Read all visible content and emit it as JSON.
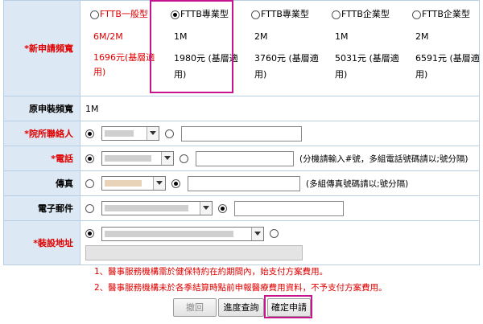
{
  "plan": {
    "label": "*新申請頻寬",
    "options": [
      {
        "name": "FTTB一般型",
        "bandwidth": "6M/2M",
        "price": "1696元(基層適用)",
        "selected": false,
        "red": true
      },
      {
        "name": "FTTB專業型",
        "bandwidth": "1M",
        "price": "1980元 (基層適用)",
        "selected": true,
        "red": false
      },
      {
        "name": "FTTB專業型",
        "bandwidth": "2M",
        "price": "3760元 (基層適用)",
        "selected": false,
        "red": false
      },
      {
        "name": "FTTB企業型",
        "bandwidth": "1M",
        "price": "5031元 (基層適用)",
        "selected": false,
        "red": false
      },
      {
        "name": "FTTB企業型",
        "bandwidth": "2M",
        "price": "6591元 (基層適用)",
        "selected": false,
        "red": false
      }
    ]
  },
  "original_bandwidth": {
    "label": "原申裝頻寬",
    "value": "1M"
  },
  "contact": {
    "label": "*院所聯絡人"
  },
  "phone": {
    "label": "*電話",
    "note": "(分機請輸入#號，多組電話號碼請以;號分隔)"
  },
  "fax": {
    "label": "傳真",
    "note": "(多組傳真號碼請以;號分隔)"
  },
  "email": {
    "label": "電子郵件"
  },
  "address": {
    "label": "*裝設地址"
  },
  "notices": [
    "1、醫事服務機構需於健保特約在約期間內，始支付方案費用。",
    "2、醫事服務機構未於各季結算時點前申報醫療費用資料，不予支付方案費用。"
  ],
  "buttons": {
    "undo": "撤回",
    "progress": "進度查詢",
    "confirm": "確定申請"
  },
  "colors": {
    "label_bg": "#dce8f3",
    "border": "#b8cfe3",
    "required": "#e00000",
    "highlight": "#c8148c"
  }
}
